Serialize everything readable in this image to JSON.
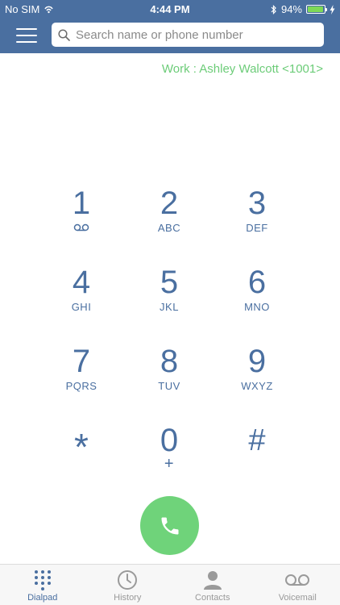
{
  "status": {
    "carrier": "No SIM",
    "time": "4:44 PM",
    "battery": "94%",
    "battery_level": 0.94
  },
  "search": {
    "placeholder": "Search name or phone number"
  },
  "account": {
    "label": "Work : Ashley Walcott <1001>"
  },
  "keypad": {
    "keys": [
      {
        "digit": "1",
        "letters": ""
      },
      {
        "digit": "2",
        "letters": "ABC"
      },
      {
        "digit": "3",
        "letters": "DEF"
      },
      {
        "digit": "4",
        "letters": "GHI"
      },
      {
        "digit": "5",
        "letters": "JKL"
      },
      {
        "digit": "6",
        "letters": "MNO"
      },
      {
        "digit": "7",
        "letters": "PQRS"
      },
      {
        "digit": "8",
        "letters": "TUV"
      },
      {
        "digit": "9",
        "letters": "WXYZ"
      },
      {
        "digit": "*",
        "letters": ""
      },
      {
        "digit": "0",
        "letters": "+"
      },
      {
        "digit": "#",
        "letters": ""
      }
    ]
  },
  "tabs": [
    {
      "label": "Dialpad",
      "icon": "dialpad-icon",
      "active": true
    },
    {
      "label": "History",
      "icon": "clock-icon",
      "active": false
    },
    {
      "label": "Contacts",
      "icon": "person-icon",
      "active": false
    },
    {
      "label": "Voicemail",
      "icon": "voicemail-icon",
      "active": false
    }
  ],
  "colors": {
    "header": "#4a6fa0",
    "accent": "#4a6fa0",
    "account_text": "#6ccc78",
    "call_button": "#6fd37a"
  }
}
